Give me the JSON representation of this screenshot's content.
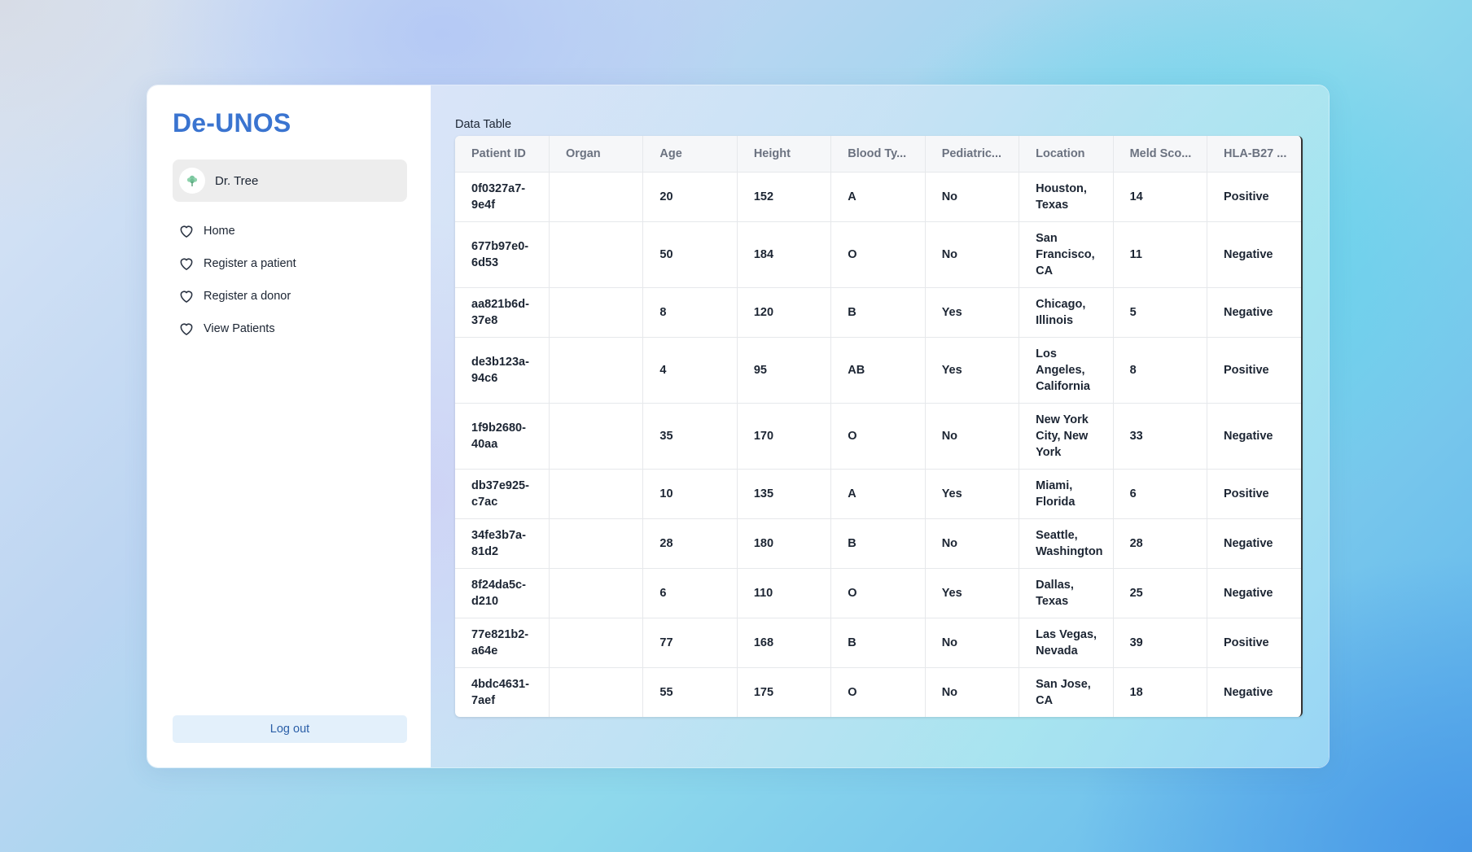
{
  "app": {
    "brand": "De-UNOS",
    "user": {
      "name": "Dr. Tree",
      "avatar_icon": "tree-icon"
    },
    "nav": [
      {
        "label": "Home",
        "icon": "heart-icon"
      },
      {
        "label": "Register a patient",
        "icon": "heart-icon"
      },
      {
        "label": "Register a donor",
        "icon": "heart-icon"
      },
      {
        "label": "View Patients",
        "icon": "heart-icon"
      }
    ],
    "logout_label": "Log out"
  },
  "main": {
    "table_title": "Data Table",
    "columns": [
      "Patient ID",
      "Organ",
      "Age",
      "Height",
      "Blood Ty...",
      "Pediatric...",
      "Location",
      "Meld Sco...",
      "HLA-B27 ..."
    ],
    "rows": [
      [
        "0f0327a7-9e4f",
        "",
        "20",
        "152",
        "A",
        "No",
        "Houston, Texas",
        "14",
        "Positive"
      ],
      [
        "677b97e0-6d53",
        "",
        "50",
        "184",
        "O",
        "No",
        "San Francisco, CA",
        "11",
        "Negative"
      ],
      [
        "aa821b6d-37e8",
        "",
        "8",
        "120",
        "B",
        "Yes",
        "Chicago, Illinois",
        "5",
        "Negative"
      ],
      [
        "de3b123a-94c6",
        "",
        "4",
        "95",
        "AB",
        "Yes",
        "Los Angeles, California",
        "8",
        "Positive"
      ],
      [
        "1f9b2680-40aa",
        "",
        "35",
        "170",
        "O",
        "No",
        "New York City, New York",
        "33",
        "Negative"
      ],
      [
        "db37e925-c7ac",
        "",
        "10",
        "135",
        "A",
        "Yes",
        "Miami, Florida",
        "6",
        "Positive"
      ],
      [
        "34fe3b7a-81d2",
        "",
        "28",
        "180",
        "B",
        "No",
        "Seattle, Washington",
        "28",
        "Negative"
      ],
      [
        "8f24da5c-d210",
        "",
        "6",
        "110",
        "O",
        "Yes",
        "Dallas, Texas",
        "25",
        "Negative"
      ],
      [
        "77e821b2-a64e",
        "",
        "77",
        "168",
        "B",
        "No",
        "Las Vegas, Nevada",
        "39",
        "Positive"
      ],
      [
        "4bdc4631-7aef",
        "",
        "55",
        "175",
        "O",
        "No",
        "San Jose, CA",
        "18",
        "Negative"
      ]
    ]
  }
}
